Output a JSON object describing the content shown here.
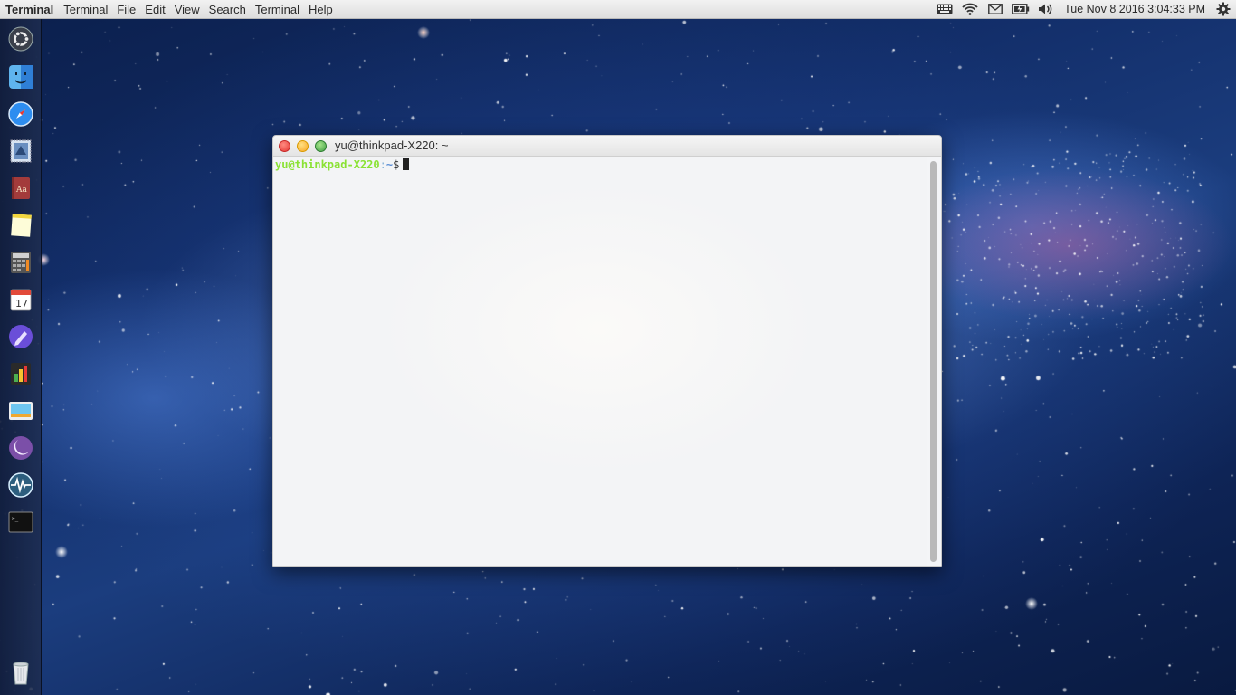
{
  "menubar": {
    "app_name": "Terminal",
    "menus": [
      "Terminal",
      "File",
      "Edit",
      "View",
      "Search",
      "Terminal",
      "Help"
    ],
    "tray_icons": [
      "keyboard-icon",
      "wifi-icon",
      "mail-icon",
      "battery-icon",
      "volume-icon"
    ],
    "clock": "Tue Nov  8 2016   3:04:33 PM",
    "settings_icon": "gear-icon"
  },
  "launcher": {
    "items": [
      {
        "name": "ubuntu-home-icon"
      },
      {
        "name": "finder-icon"
      },
      {
        "name": "safari-browser-icon"
      },
      {
        "name": "mail-stamp-icon"
      },
      {
        "name": "dictionary-icon"
      },
      {
        "name": "notes-icon"
      },
      {
        "name": "calculator-icon"
      },
      {
        "name": "calendar-icon",
        "label": "17"
      },
      {
        "name": "pen-app-icon"
      },
      {
        "name": "spreadsheet-chart-icon"
      },
      {
        "name": "image-viewer-icon"
      },
      {
        "name": "moon-app-icon"
      },
      {
        "name": "system-monitor-icon"
      },
      {
        "name": "terminal-icon",
        "label": ">_"
      }
    ],
    "trash": {
      "name": "trash-icon"
    }
  },
  "window": {
    "title": "yu@thinkpad-X220: ~",
    "prompt_user": "yu@thinkpad-X220",
    "prompt_sep": ":",
    "prompt_path": "~",
    "prompt_sign": "$"
  },
  "colors": {
    "menubar_bg": "#e8e8e8",
    "prompt_green": "#8ae234",
    "prompt_blue": "#5c8fd6"
  }
}
